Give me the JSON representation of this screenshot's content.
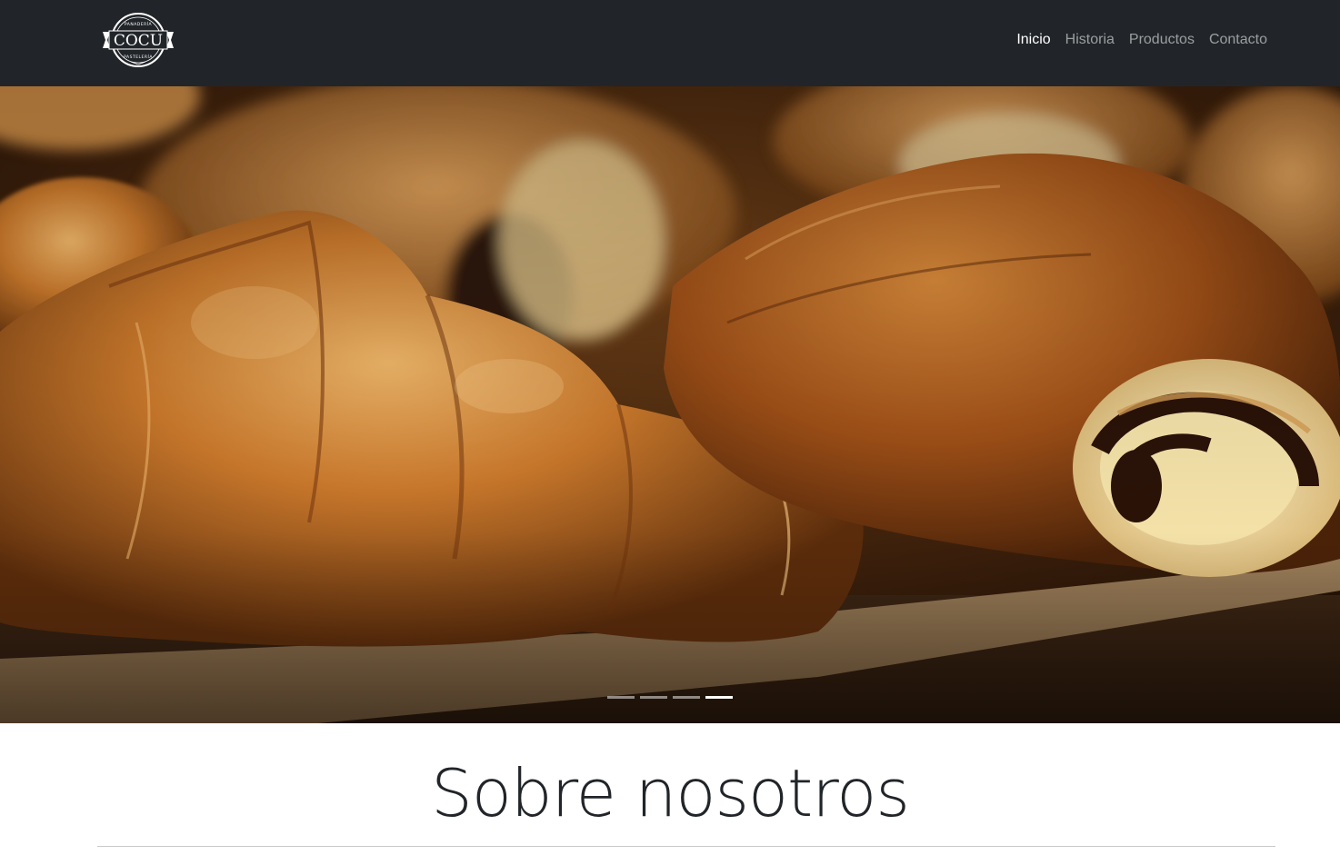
{
  "brand": {
    "logo_text": "COCU",
    "logo_arc_top": "PANADERÍA",
    "logo_arc_bottom": "PASTELERÍA"
  },
  "nav": {
    "items": [
      {
        "label": "Inicio",
        "active": true
      },
      {
        "label": "Historia",
        "active": false
      },
      {
        "label": "Productos",
        "active": false
      },
      {
        "label": "Contacto",
        "active": false
      }
    ]
  },
  "carousel": {
    "slide_count": 4,
    "active_index": 3,
    "image_subject": "croissants and pain au chocolat"
  },
  "about": {
    "title": "Sobre nosotros"
  },
  "colors": {
    "navbar_bg": "#212529",
    "nav_active": "#ffffff",
    "nav_inactive": "rgba(255,255,255,0.55)",
    "title_text": "#212529"
  }
}
